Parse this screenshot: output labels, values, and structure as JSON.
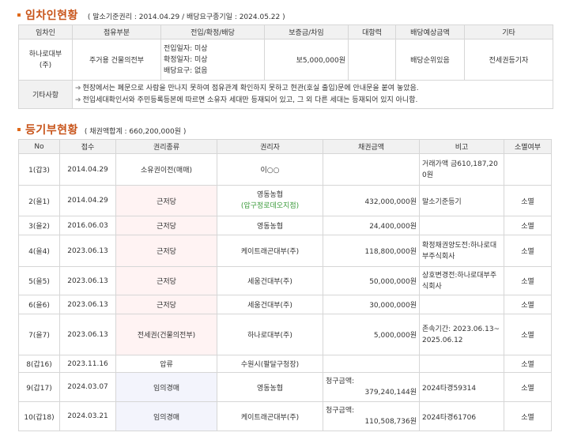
{
  "lease_section": {
    "title": "임차인현황",
    "note": "( 말소기준권리 : 2014.04.29 / 배당요구종기일 : 2024.05.22 )",
    "headers": [
      "임차인",
      "점유부분",
      "전입/확정/배당",
      "보증금/차임",
      "대항력",
      "배당예상금액",
      "기타"
    ],
    "row": {
      "tenant_line1": "하나로대부",
      "tenant_line2": "(주)",
      "part": "주거용 건물의전부",
      "move_in": "전입일자: 미상",
      "confirmed": "확정일자: 미상",
      "dividend_req": "배당요구: 없음",
      "deposit": "보5,000,000원",
      "opposing": "",
      "expected": "배당순위있음",
      "etc": "전세권등기자"
    },
    "etc_label": "기타사항",
    "etc_lines": [
      "현장에서는 폐문으로 사람을 만나지 못하여 점유관계 확인하지 못하고 현관(호실 출입)문에 안내문을 붙여 놓았음.",
      "전입세대확인서와 주민등록등본에 따르면 소유자 세대만 등재되어 있고, 그 외 다른 세대는 등재되어 있지 아니함."
    ]
  },
  "registry_section": {
    "title": "등기부현황",
    "note": "( 채권액합계 : 660,200,000원 )",
    "headers": [
      "No",
      "접수",
      "권리종류",
      "권리자",
      "채권금액",
      "비고",
      "소멸여부"
    ],
    "rows": [
      {
        "no": "1(갑3)",
        "date": "2014.04.29",
        "kind": "소유권이전(매매)",
        "holder": "이○○",
        "holder_sub": "",
        "amount_label": "",
        "amount": "",
        "note": "거래가액 금610,187,200원",
        "extinct": ""
      },
      {
        "no": "2(을1)",
        "date": "2014.04.29",
        "kind": "근저당",
        "holder": "영동농협",
        "holder_sub": "(압구정로데오지점)",
        "amount_label": "",
        "amount": "432,000,000원",
        "note": "말소기준등기",
        "extinct": "소멸"
      },
      {
        "no": "3(을2)",
        "date": "2016.06.03",
        "kind": "근저당",
        "holder": "영동농협",
        "holder_sub": "",
        "amount_label": "",
        "amount": "24,400,000원",
        "note": "",
        "extinct": "소멸"
      },
      {
        "no": "4(을4)",
        "date": "2023.06.13",
        "kind": "근저당",
        "holder": "케이트래곤대부(주)",
        "holder_sub": "",
        "amount_label": "",
        "amount": "118,800,000원",
        "note": "확정채권양도전:하나로대부주식회사",
        "extinct": "소멸"
      },
      {
        "no": "5(을5)",
        "date": "2023.06.13",
        "kind": "근저당",
        "holder": "세움건대부(주)",
        "holder_sub": "",
        "amount_label": "",
        "amount": "50,000,000원",
        "note": "상호변경전:하나로대부주식회사",
        "extinct": "소멸"
      },
      {
        "no": "6(을6)",
        "date": "2023.06.13",
        "kind": "근저당",
        "holder": "세움건대부(주)",
        "holder_sub": "",
        "amount_label": "",
        "amount": "30,000,000원",
        "note": "",
        "extinct": "소멸"
      },
      {
        "no": "7(을7)",
        "date": "2023.06.13",
        "kind": "전세권(건물의전부)",
        "holder": "하나로대부(주)",
        "holder_sub": "",
        "amount_label": "",
        "amount": "5,000,000원",
        "note": "존속기간: 2023.06.13~2025.06.12",
        "extinct": "소멸"
      },
      {
        "no": "8(갑16)",
        "date": "2023.11.16",
        "kind": "압류",
        "holder": "수원시(팔달구청장)",
        "holder_sub": "",
        "amount_label": "",
        "amount": "",
        "note": "",
        "extinct": "소멸"
      },
      {
        "no": "9(갑17)",
        "date": "2024.03.07",
        "kind": "임의경매",
        "holder": "영동농협",
        "holder_sub": "",
        "amount_label": "청구금액:",
        "amount": "379,240,144원",
        "note": "2024타경59314",
        "extinct": "소멸"
      },
      {
        "no": "10(갑18)",
        "date": "2024.03.21",
        "kind": "임의경매",
        "holder": "케이트래곤대부(주)",
        "holder_sub": "",
        "amount_label": "청구금액:",
        "amount": "110,508,736원",
        "note": "2024타경61706",
        "extinct": "소멸"
      }
    ]
  }
}
